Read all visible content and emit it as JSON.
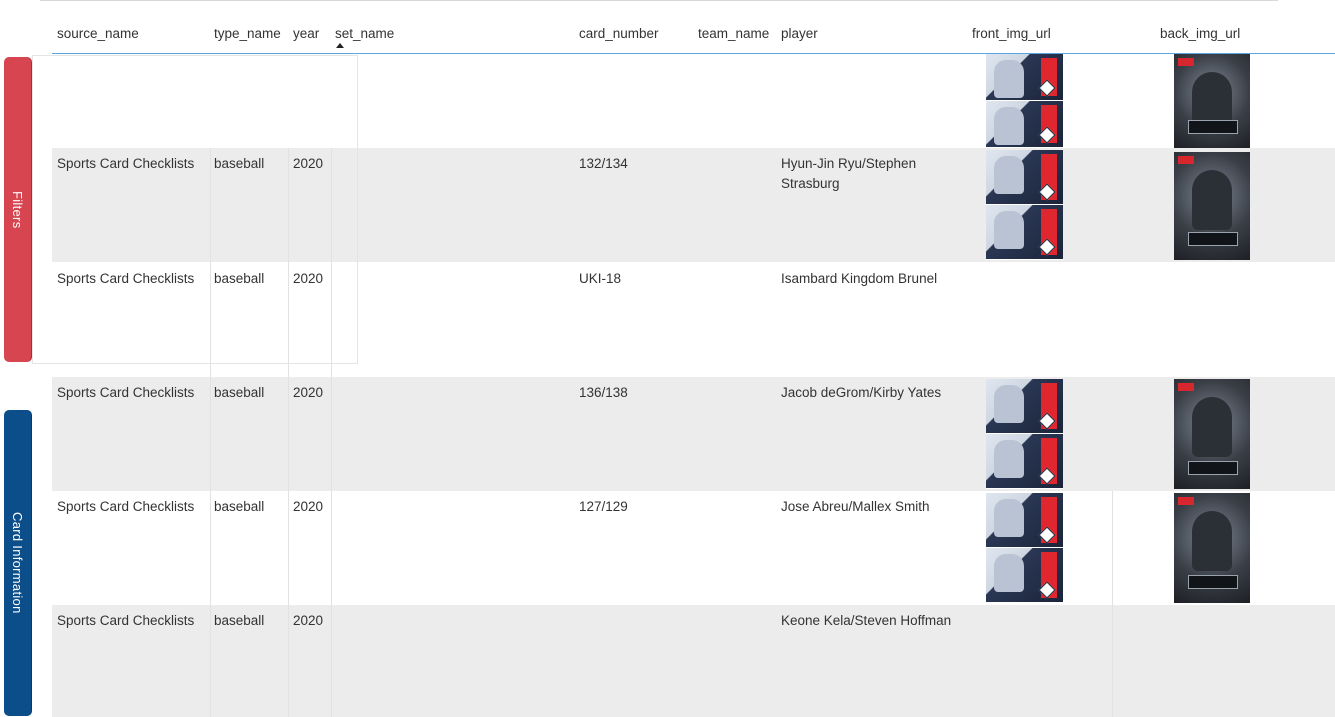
{
  "side_tabs": {
    "filters": "Filters",
    "card_information": "Card Information"
  },
  "table": {
    "columns": {
      "source_name": "source_name",
      "type_name": "type_name",
      "year": "year",
      "set_name": "set_name",
      "card_number": "card_number",
      "team_name": "team_name",
      "player": "player",
      "front_img_url": "front_img_url",
      "back_img_url": "back_img_url"
    },
    "sorted_column": "set_name",
    "rows": [
      {
        "source_name": "",
        "type_name": "",
        "year": "",
        "set_name": "",
        "card_number": "",
        "team_name": "",
        "player": "",
        "front_img": "card-front-image",
        "back_img": "card-back-image"
      },
      {
        "source_name": "Sports Card Checklists",
        "type_name": "baseball",
        "year": "2020",
        "set_name": "",
        "card_number": "132/134",
        "team_name": "",
        "player": "Hyun-Jin Ryu/Stephen Strasburg",
        "front_img": "card-front-image",
        "back_img": "card-back-image"
      },
      {
        "source_name": "Sports Card Checklists",
        "type_name": "baseball",
        "year": "2020",
        "set_name": "",
        "card_number": "UKI-18",
        "team_name": "",
        "player": "Isambard Kingdom Brunel",
        "front_img": "",
        "back_img": ""
      },
      {
        "source_name": "Sports Card Checklists",
        "type_name": "baseball",
        "year": "2020",
        "set_name": "",
        "card_number": "136/138",
        "team_name": "",
        "player": "Jacob deGrom/Kirby Yates",
        "front_img": "card-front-image",
        "back_img": "card-back-image"
      },
      {
        "source_name": "Sports Card Checklists",
        "type_name": "baseball",
        "year": "2020",
        "set_name": "",
        "card_number": "127/129",
        "team_name": "",
        "player": "Jose Abreu/Mallex Smith",
        "front_img": "card-front-image",
        "back_img": "card-back-image"
      },
      {
        "source_name": "Sports Card Checklists",
        "type_name": "baseball",
        "year": "2020",
        "set_name": "",
        "card_number": "",
        "team_name": "",
        "player": "Keone Kela/Steven Hoffman",
        "front_img": "",
        "back_img": ""
      }
    ]
  },
  "colors": {
    "filters_tab": "#d64550",
    "card_info_tab": "#0b4e8a",
    "header_underline": "#5aa6e0",
    "row_alt": "#ececec"
  }
}
